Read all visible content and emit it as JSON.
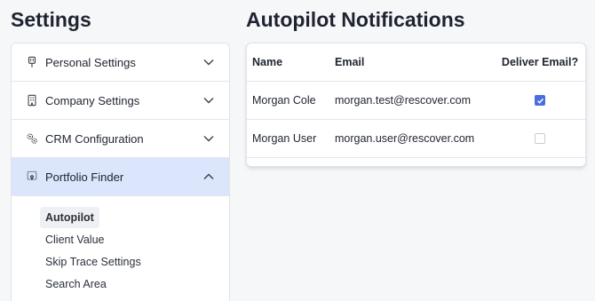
{
  "settings_title": "Settings",
  "sidebar": {
    "items": [
      {
        "label": "Personal Settings",
        "icon": "badge-icon",
        "expanded": false
      },
      {
        "label": "Company Settings",
        "icon": "building-icon",
        "expanded": false
      },
      {
        "label": "CRM Configuration",
        "icon": "gears-icon",
        "expanded": false
      },
      {
        "label": "Portfolio Finder",
        "icon": "map-pin-icon",
        "expanded": true
      }
    ],
    "sub_items": [
      {
        "label": "Autopilot",
        "active": true
      },
      {
        "label": "Client Value",
        "active": false
      },
      {
        "label": "Skip Trace Settings",
        "active": false
      },
      {
        "label": "Search Area",
        "active": false
      }
    ]
  },
  "main": {
    "title": "Autopilot Notifications",
    "table": {
      "columns": [
        "Name",
        "Email",
        "Deliver Email?"
      ],
      "rows": [
        {
          "name": "Morgan Cole",
          "email": "morgan.test@rescover.com",
          "deliver": true
        },
        {
          "name": "Morgan User",
          "email": "morgan.user@rescover.com",
          "deliver": false
        }
      ]
    }
  },
  "colors": {
    "accent": "#4a6ee0",
    "active_nav_bg": "#dbe5fb"
  }
}
